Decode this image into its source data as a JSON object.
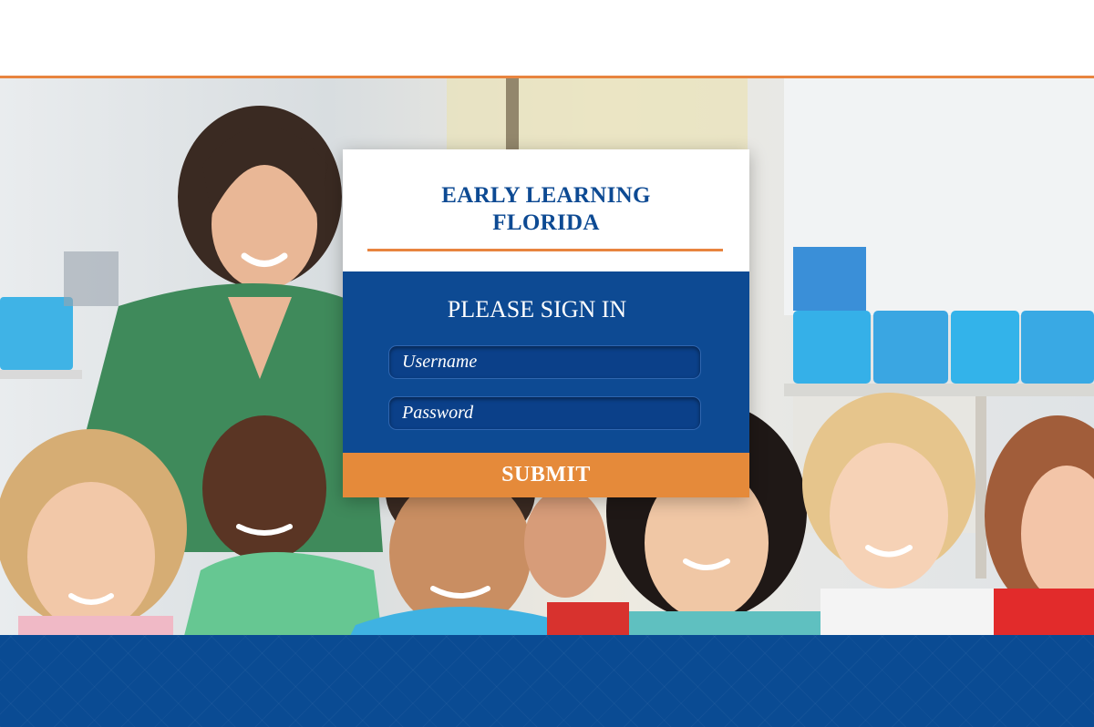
{
  "brand": {
    "title_line1": "EARLY LEARNING",
    "title_line2": "FLORIDA",
    "color": "#0d4a93",
    "accent_color": "#e8843f"
  },
  "signin": {
    "heading": "PLEASE SIGN IN",
    "username_placeholder": "Username",
    "password_placeholder": "Password",
    "submit_label": "SUBMIT",
    "panel_color": "#0d4a93",
    "button_color": "#e58a3a"
  },
  "hero": {
    "image_subject": "classroom-teacher-with-children-photo"
  },
  "footer": {
    "color": "#0a4b93"
  }
}
